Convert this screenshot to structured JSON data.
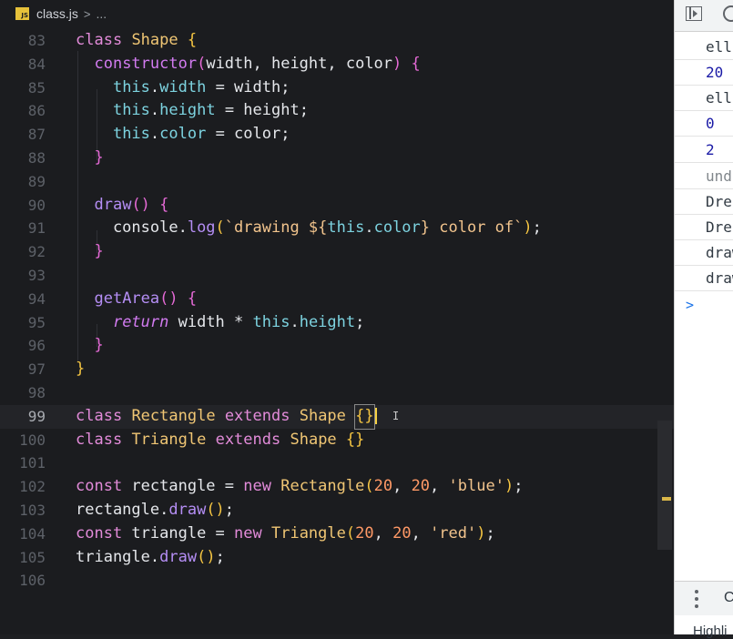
{
  "tab": {
    "file_name": "class.js",
    "badge": "JS",
    "separator": ">",
    "more": "..."
  },
  "code_lines": [
    {
      "n": "83"
    },
    {
      "n": "84"
    },
    {
      "n": "85"
    },
    {
      "n": "86"
    },
    {
      "n": "87"
    },
    {
      "n": "88"
    },
    {
      "n": "89"
    },
    {
      "n": "90"
    },
    {
      "n": "91"
    },
    {
      "n": "92"
    },
    {
      "n": "93"
    },
    {
      "n": "94"
    },
    {
      "n": "95"
    },
    {
      "n": "96"
    },
    {
      "n": "97"
    },
    {
      "n": "98"
    },
    {
      "n": "99"
    },
    {
      "n": "100"
    },
    {
      "n": "101"
    },
    {
      "n": "102"
    },
    {
      "n": "103"
    },
    {
      "n": "104"
    },
    {
      "n": "105"
    },
    {
      "n": "106"
    }
  ],
  "console_rows": [
    "ell",
    "20",
    "ell",
    "0",
    "2",
    "und",
    "Dre",
    "Dre",
    "draw",
    "draw"
  ],
  "console_prompt": ">",
  "bottom": {
    "label": "C",
    "drawer_text": "Highli"
  },
  "colors": {
    "editor_bg": "#1b1c1f",
    "keyword": "#e28bd9",
    "class_name": "#f0c674",
    "this": "#7dd3e0",
    "number": "#ff9966",
    "string": "#f2c48d"
  }
}
